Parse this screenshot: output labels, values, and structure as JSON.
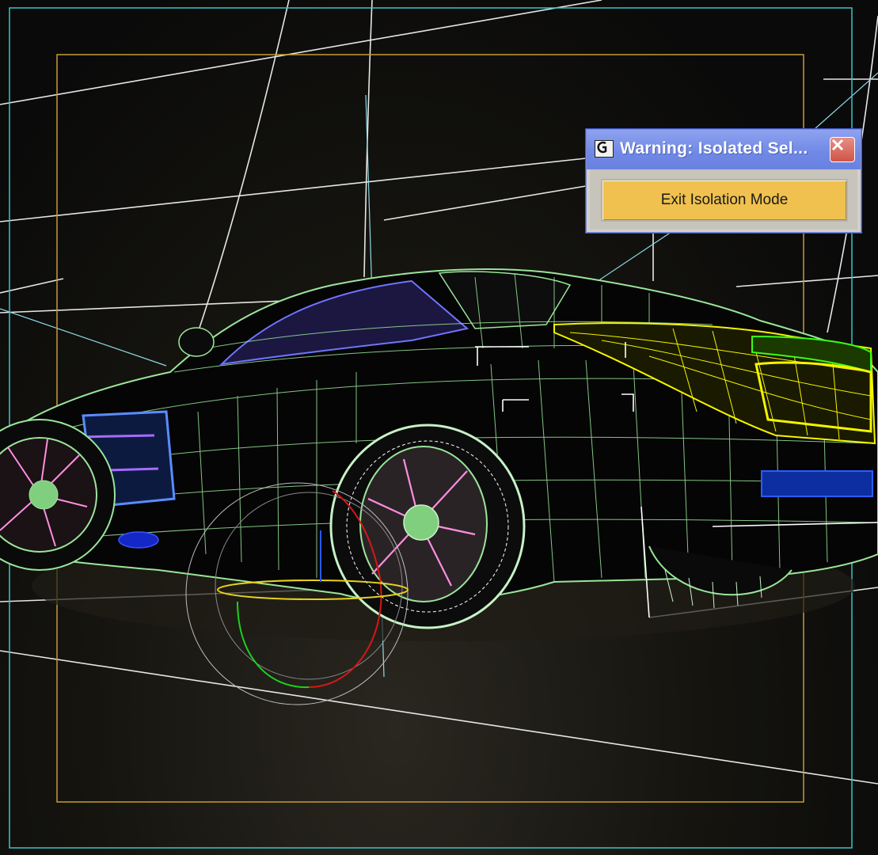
{
  "dialog": {
    "title": "Warning: Isolated Sel...",
    "button_label": "Exit Isolation Mode"
  },
  "colors": {
    "viewport_background": "#0d0d0c",
    "wireframe": "#9ae59a",
    "safe_frame_outer": "#38c5c8",
    "safe_frame_inner": "#c79a36",
    "selection": "#f4f400",
    "dialog_title": "#7189e3",
    "button_fill": "#f0c14e"
  },
  "icons": {
    "app": "3ds-max-app-icon",
    "close": "close-icon"
  }
}
